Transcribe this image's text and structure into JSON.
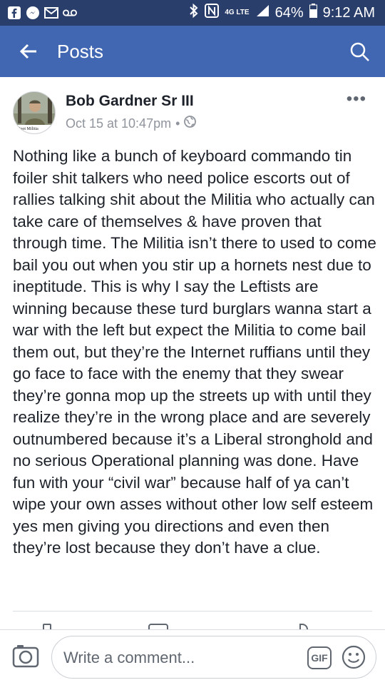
{
  "status_bar": {
    "lte_label": "4G LTE",
    "battery": "64%",
    "time": "9:12 AM"
  },
  "app_bar": {
    "title": "Posts"
  },
  "post": {
    "author": "Bob Gardner Sr III",
    "timestamp": "Oct 15 at 10:47pm",
    "separator": "•",
    "more_label": "•••",
    "avatar_caption": "Foot Militia",
    "body": "Nothing like a bunch of keyboard commando tin foiler shit talkers who need police escorts out of rallies talking shit about the Militia who actually can take care of themselves & have proven that through time. The Militia isn’t there to used to come bail you out when you stir up a hornets nest due to ineptitude. This is why I say the Leftists are winning because these turd burglars wanna start a war with the left but expect the Militia to come bail them out, but they’re the Internet ruffians until they go face to face with the enemy that they swear they’re gonna mop up the streets up with until they realize they’re in the wrong place and are severely outnumbered because it’s a Liberal stronghold and no serious Operational planning was done.  Have fun with your “civil war” because half of ya can’t wipe your own asses without other low self esteem yes men giving you directions and even then they’re lost because they don’t have a clue."
  },
  "comment_bar": {
    "placeholder": "Write a comment...",
    "gif_label": "GIF"
  }
}
